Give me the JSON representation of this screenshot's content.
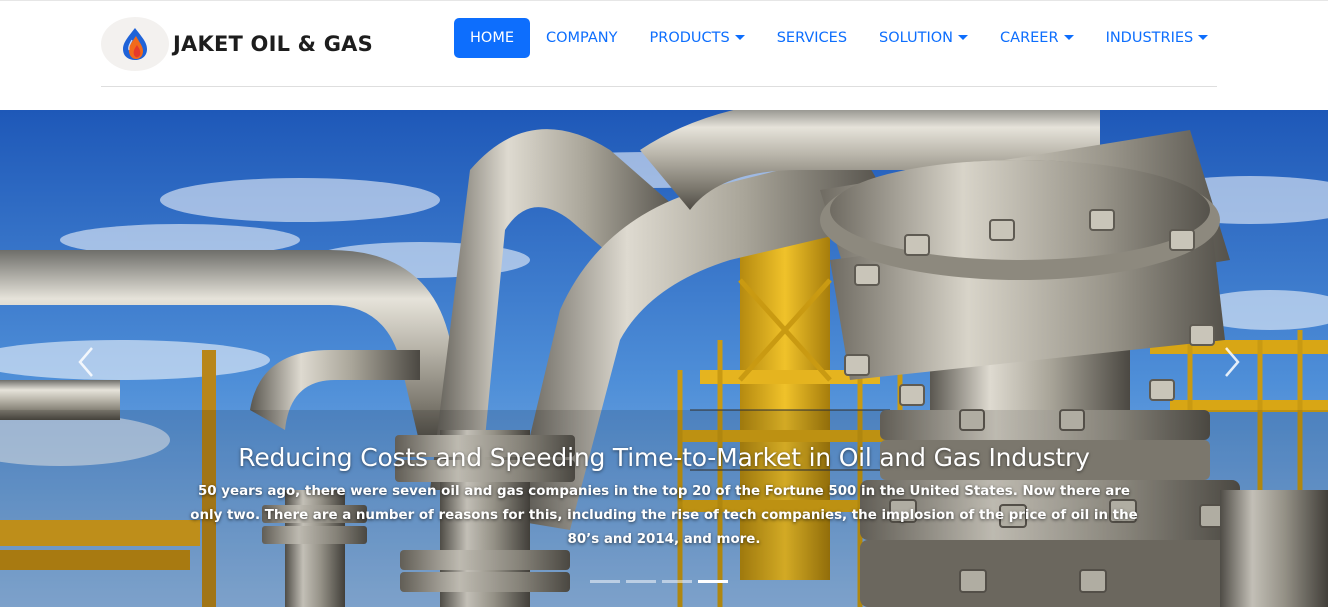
{
  "brand": {
    "name": "JAKET OIL & GAS",
    "logo_icon": "flame-drop-icon",
    "colors": {
      "flame_blue": "#1f63d8",
      "flame_orange": "#f26a1b",
      "flame_red": "#e53a2b"
    }
  },
  "nav": {
    "items": [
      {
        "label": "HOME",
        "active": true,
        "dropdown": false
      },
      {
        "label": "COMPANY",
        "active": false,
        "dropdown": false
      },
      {
        "label": "PRODUCTS",
        "active": false,
        "dropdown": true
      },
      {
        "label": "SERVICES",
        "active": false,
        "dropdown": false
      },
      {
        "label": "SOLUTION",
        "active": false,
        "dropdown": true
      },
      {
        "label": "CAREER",
        "active": false,
        "dropdown": true
      },
      {
        "label": "INDUSTRIES",
        "active": false,
        "dropdown": true
      }
    ],
    "accent_color": "#0d6efd"
  },
  "carousel": {
    "title": "Reducing Costs and Speeding Time-to-Market in Oil and Gas Industry",
    "text": "50 years ago, there were seven oil and gas companies in the top 20 of the Fortune 500 in the United States. Now there are only two. There are a number of reasons for this, including the rise of tech companies, the implosion of the price of oil in the 80’s and 2014, and more.",
    "prev_icon": "chevron-left-icon",
    "next_icon": "chevron-right-icon",
    "slide_count": 4,
    "active_slide": 4
  }
}
